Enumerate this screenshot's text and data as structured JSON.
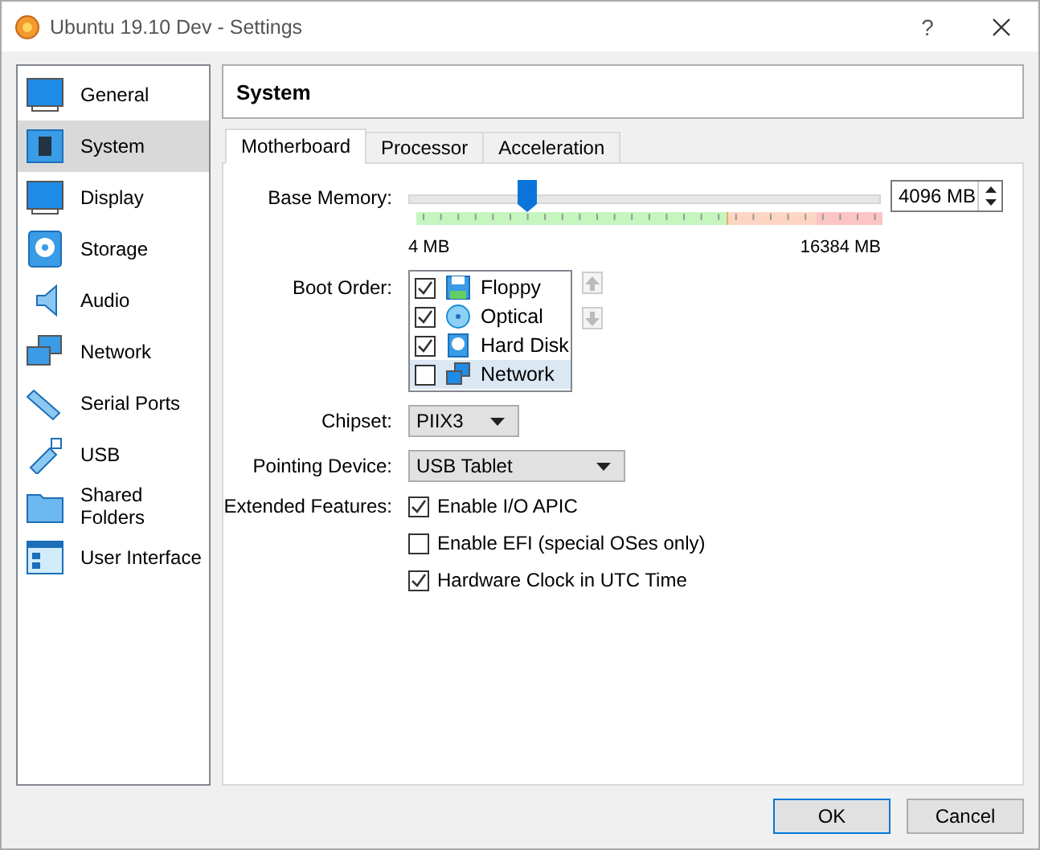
{
  "window": {
    "title": "Ubuntu 19.10 Dev - Settings",
    "help": "?"
  },
  "sidebar": {
    "items": [
      {
        "label": "General",
        "selected": false
      },
      {
        "label": "System",
        "selected": true
      },
      {
        "label": "Display",
        "selected": false
      },
      {
        "label": "Storage",
        "selected": false
      },
      {
        "label": "Audio",
        "selected": false
      },
      {
        "label": "Network",
        "selected": false
      },
      {
        "label": "Serial Ports",
        "selected": false
      },
      {
        "label": "USB",
        "selected": false
      },
      {
        "label": "Shared Folders",
        "selected": false
      },
      {
        "label": "User Interface",
        "selected": false
      }
    ]
  },
  "section_title": "System",
  "tabs": [
    {
      "label": "Motherboard",
      "selected": true
    },
    {
      "label": "Processor",
      "selected": false
    },
    {
      "label": "Acceleration",
      "selected": false
    }
  ],
  "base_memory": {
    "label": "Base Memory:",
    "level": 0.25,
    "value": "4096 MB",
    "min": "4 MB",
    "max": "16384 MB"
  },
  "boot_order": {
    "label": "Boot Order:",
    "items": [
      {
        "label": "Floppy",
        "checked": true,
        "selected": false
      },
      {
        "label": "Optical",
        "checked": true,
        "selected": false
      },
      {
        "label": "Hard Disk",
        "checked": true,
        "selected": false
      },
      {
        "label": "Network",
        "checked": false,
        "selected": true
      }
    ]
  },
  "chipset": {
    "label": "Chipset:",
    "value": "PIIX3"
  },
  "pointing_device": {
    "label": "Pointing Device:",
    "value": "USB Tablet"
  },
  "extended_features": {
    "label": "Extended Features:",
    "options": [
      {
        "label": "Enable I/O APIC",
        "checked": true
      },
      {
        "label": "Enable EFI (special OSes only)",
        "checked": false
      },
      {
        "label": "Hardware Clock in UTC Time",
        "checked": true
      }
    ]
  },
  "buttons": [
    "OK",
    "Cancel"
  ]
}
